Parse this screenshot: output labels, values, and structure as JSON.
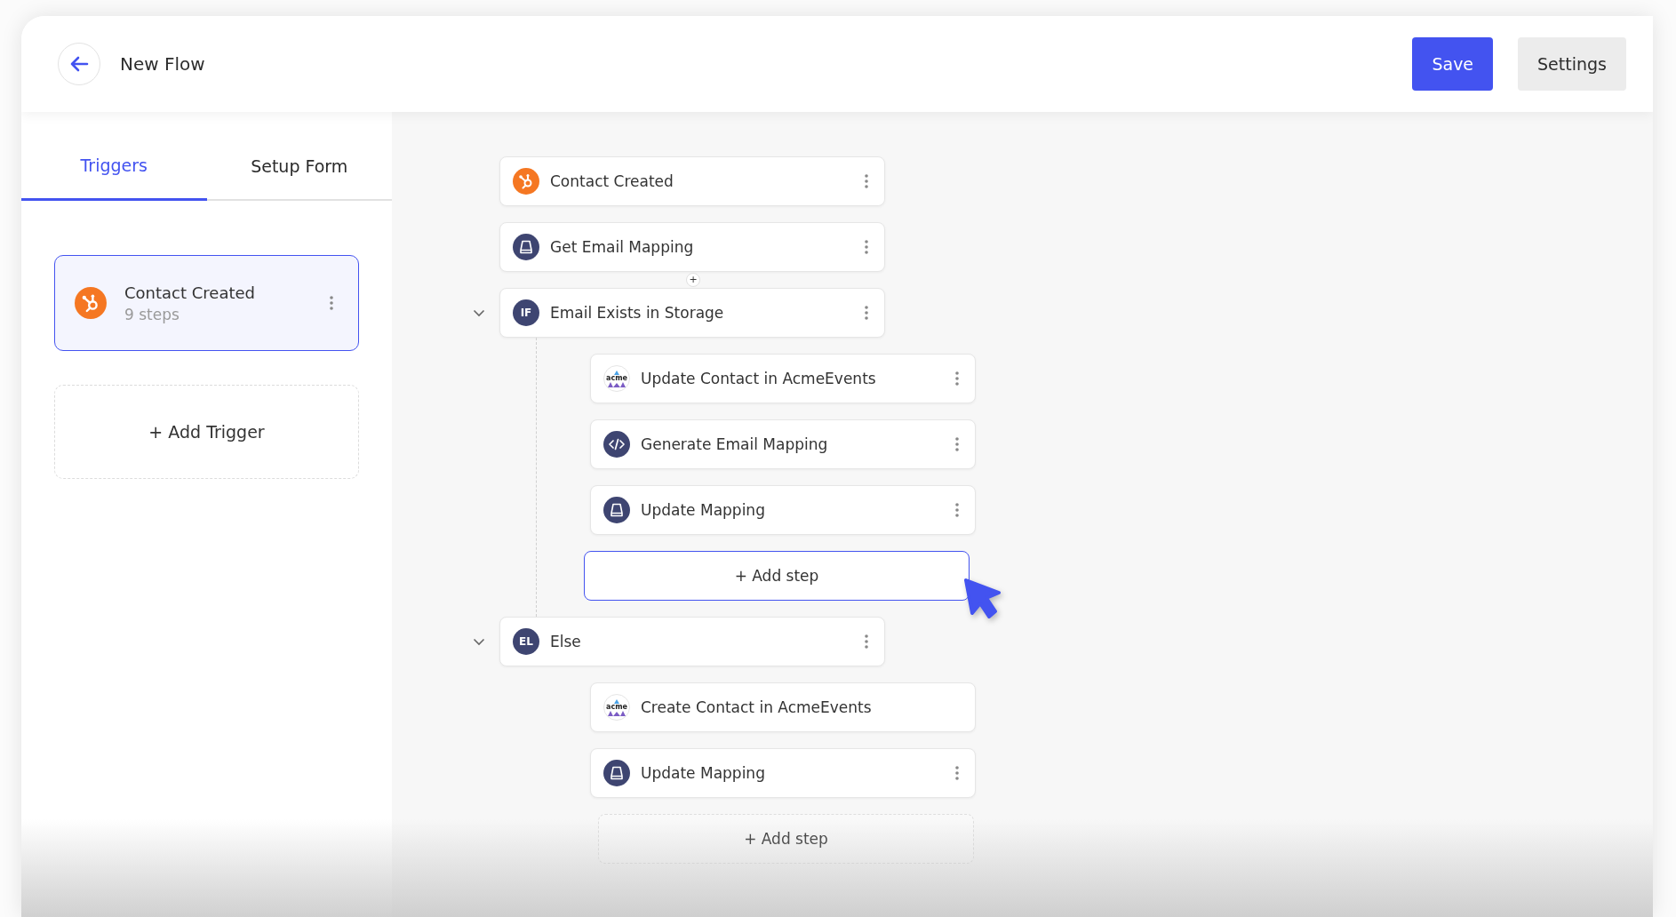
{
  "header": {
    "title": "New Flow",
    "buttons": [
      {
        "label": "Save",
        "kind": "primary"
      },
      {
        "label": "Settings",
        "kind": "secondary"
      }
    ]
  },
  "sidebar": {
    "tabs": [
      {
        "label": "Triggers",
        "selected": true
      },
      {
        "label": "Setup Form",
        "selected": false
      }
    ],
    "triggers": [
      {
        "title": "Contact Created",
        "subtitle": "9 steps",
        "kind": "hubspot",
        "selected": true
      }
    ],
    "add_trigger": "+ Add Trigger"
  },
  "flow": {
    "steps": [
      {
        "kind": "hubspot",
        "title": "Contact Created",
        "menu": true
      },
      {
        "kind": "storage",
        "title": "Get Email Mapping",
        "menu": true
      },
      {
        "kind": "insert",
        "label": "+"
      },
      {
        "kind": "branch",
        "badge": "IF",
        "title": "Email Exists in Storage",
        "menu": true,
        "expanded": true,
        "connector": true,
        "children": [
          {
            "kind": "acme",
            "logo_text": "acme",
            "title": "Update Contact in AcmeEvents",
            "menu": true
          },
          {
            "kind": "code",
            "title": "Generate Email Mapping",
            "menu": true
          },
          {
            "kind": "storage",
            "title": "Update Mapping",
            "menu": true
          },
          {
            "kind": "add",
            "label": "+ Add step",
            "highlighted": true
          }
        ]
      },
      {
        "kind": "branch",
        "badge": "EL",
        "title": "Else",
        "menu": true,
        "expanded": true,
        "connector": false,
        "children": [
          {
            "kind": "acme",
            "logo_text": "acme",
            "title": "Create Contact in AcmeEvents",
            "menu": false
          },
          {
            "kind": "storage",
            "title": "Update Mapping",
            "menu": true
          },
          {
            "kind": "add",
            "label": "+ Add step",
            "highlighted": false
          }
        ]
      }
    ]
  }
}
